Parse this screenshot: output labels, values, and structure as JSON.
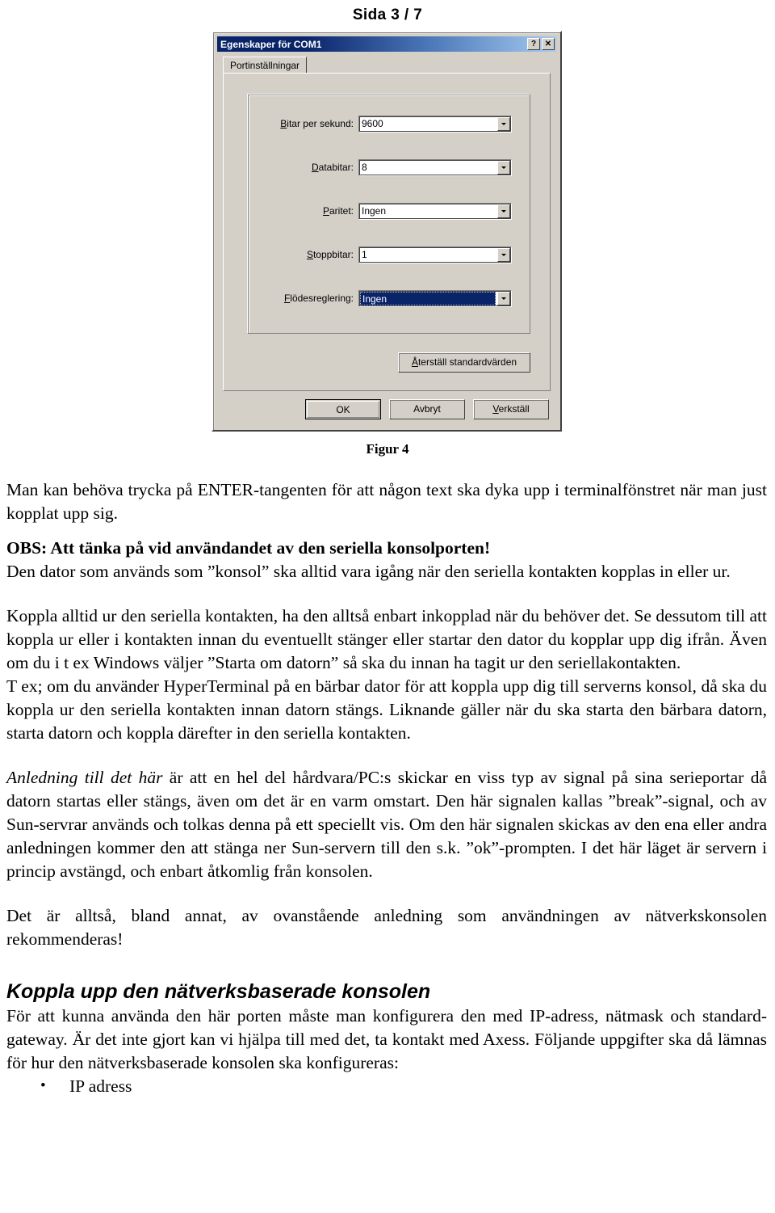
{
  "header": {
    "page_indicator": "Sida 3 / 7"
  },
  "dialog": {
    "title": "Egenskaper för COM1",
    "help_button": "?",
    "close_button": "✕",
    "tab": "Portinställningar",
    "fields": [
      {
        "label_accesskey": "B",
        "label_rest": "itar per sekund:",
        "value": "9600",
        "selected": false
      },
      {
        "label_accesskey": "D",
        "label_rest": "atabitar:",
        "value": "8",
        "selected": false
      },
      {
        "label_accesskey": "P",
        "label_rest": "aritet:",
        "value": "Ingen",
        "selected": false
      },
      {
        "label_accesskey": "S",
        "label_rest": "toppbitar:",
        "value": "1",
        "selected": false
      },
      {
        "label_accesskey": "F",
        "label_rest": "lödesreglering:",
        "value": "Ingen",
        "selected": true
      }
    ],
    "restore_accesskey": "Å",
    "restore_rest": "terställ standardvärden",
    "ok_label": "OK",
    "cancel_label": "Avbryt",
    "apply_accesskey": "V",
    "apply_rest": "erkställ",
    "colors": {
      "face": "#d4d0c8",
      "title_start": "#0a246a",
      "title_end": "#a6caf0",
      "selection": "#0a246a"
    }
  },
  "figure": {
    "caption": "Figur 4"
  },
  "body": {
    "p1": "Man kan behöva trycka på ENTER-tangenten för att någon text ska dyka upp i terminalfönstret när man just kopplat upp sig.",
    "obs_heading": "OBS: Att tänka på vid användandet av den seriella konsolporten!",
    "p2": "Den dator som används som ”konsol” ska alltid vara igång när den seriella kontakten kopplas in eller ur.",
    "p3": "Koppla alltid ur den seriella kontakten, ha den alltså enbart inkopplad när du behöver det. Se dessutom till att koppla ur eller i kontakten innan du eventuellt stänger eller startar den dator du kopplar upp dig ifrån. Även om du i t ex Windows väljer ”Starta om datorn” så ska du innan ha tagit ur den seriellakontakten.",
    "p4": "T ex; om du använder HyperTerminal på en bärbar dator för att koppla upp dig till serverns konsol, då ska du koppla ur den seriella kontakten innan datorn stängs. Liknande gäller när du ska starta den bärbara datorn, starta datorn och koppla därefter in den seriella kontakten.",
    "p5_italic_lead": "Anledning till det här",
    "p5_rest": " är att en hel del hårdvara/PC:s skickar en viss typ av signal på sina serieportar då datorn startas eller stängs, även om det är en varm omstart. Den här signalen kallas ”break”-signal, och av Sun-servrar används och tolkas denna på ett speciellt vis. Om den här signalen skickas av den ena eller andra anledningen kommer den att stänga ner Sun-servern till den s.k. ”ok”-prompten. I det här läget är servern i princip avstängd, och enbart åtkomlig från konsolen.",
    "p6": "Det är alltså, bland annat, av ovanstående anledning som användningen av nätverkskonsolen rekommenderas!",
    "section_heading": "Koppla upp den nätverksbaserade konsolen",
    "p7": "För att kunna använda den här porten måste man konfigurera den med IP-adress, nätmask och standard-gateway. Är det inte gjort kan vi hjälpa till med det, ta kontakt med Axess. Följande uppgifter ska då lämnas för hur den nätverksbaserade konsolen ska konfigureras:",
    "bullets": [
      "IP adress"
    ]
  }
}
